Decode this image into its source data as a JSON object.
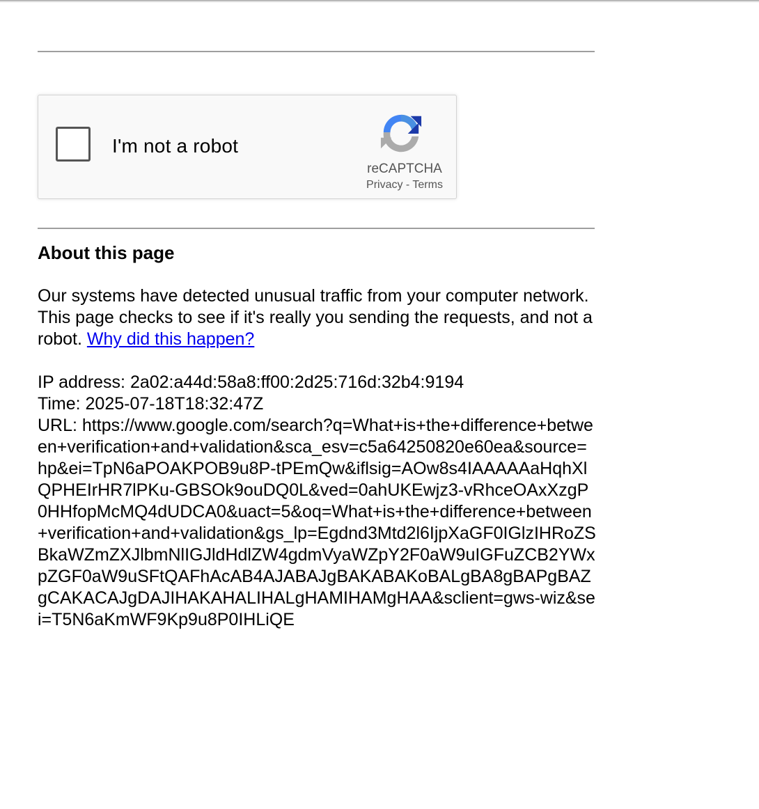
{
  "recaptcha": {
    "checkbox_label": "I'm not a robot",
    "brand": "reCAPTCHA",
    "privacy_link": "Privacy",
    "separator": "-",
    "terms_link": "Terms",
    "logo_icon": "recaptcha-logo-icon"
  },
  "about": {
    "title": "About this page",
    "message": "Our systems have detected unusual traffic from your computer network. This page checks to see if it's really you sending the requests, and not a robot. ",
    "why_link": "Why did this happen?"
  },
  "details": {
    "ip": "IP address: 2a02:a44d:58a8:ff00:2d25:716d:32b4:9194",
    "time": "Time: 2025-07-18T18:32:47Z",
    "url": "URL: https://www.google.com/search?q=What+is+the+difference+between+verification+and+validation&sca_esv=c5a64250820e60ea&source=hp&ei=TpN6aPOAKPOB9u8P-tPEmQw&iflsig=AOw8s4IAAAAAaHqhXlQPHEIrHR7lPKu-GBSOk9ouDQ0L&ved=0ahUKEwjz3-vRhceOAxXzgP0HHfopMcMQ4dUDCA0&uact=5&oq=What+is+the+difference+between+verification+and+validation&gs_lp=Egdnd3Mtd2l6IjpXaGF0IGlzIHRoZSBkaWZmZXJlbmNlIGJldHdlZW4gdmVyaWZpY2F0aW9uIGFuZCB2YWxpZGF0aW9uSFtQAFhAcAB4AJABAJgBAKABAKoBALgBA8gBAPgBAZgCAKACAJgDAJIHAKAHALIHALgHAMIHAMgHAA&sclient=gws-wiz&sei=T5N6aKmWF9Kp9u8P0IHLiQE"
  },
  "colors": {
    "link": "#0000ee",
    "rule": "#9e9e9e",
    "captcha_bg": "#f9f9f9"
  }
}
